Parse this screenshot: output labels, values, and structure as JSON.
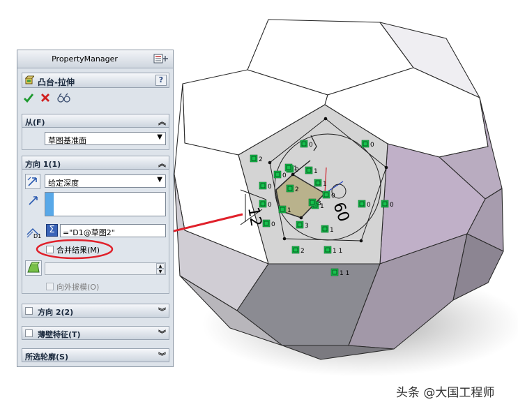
{
  "panel": {
    "title": "PropertyManager",
    "feature_title": "凸台-拉伸",
    "help": "?",
    "from": {
      "label": "从(F)",
      "value": "草图基准面"
    },
    "direction1": {
      "label": "方向 1(1)",
      "end_condition": "给定深度",
      "depth_equation": "=\"D1@草图2\"",
      "depth_icon_label": "D1",
      "merge_result": "合并结果(M)",
      "draft_outward": "向外拔模(O)"
    },
    "direction2": {
      "label": "方向 2(2)"
    },
    "thin_feature": {
      "label": "薄壁特征(T)"
    },
    "selected_contours": {
      "label": "所选轮廓(S)"
    }
  },
  "sketch": {
    "dim_left": "12",
    "dim_right": "60",
    "relation_labels": [
      "2",
      "0",
      "0",
      "0",
      "0",
      "1",
      "1",
      "0",
      "2",
      "1",
      "1",
      "1",
      "3",
      "3",
      "1",
      "0",
      "2",
      "1 1",
      "1 1",
      "0",
      "0",
      "0",
      "0"
    ]
  },
  "colors": {
    "accent_red": "#e0202a",
    "sketch_green": "#16c24d",
    "face_white": "#ffffff",
    "face_purple": "#b6a6bd",
    "face_dark": "#8f8f98"
  },
  "watermark": "头条 @大国工程师"
}
